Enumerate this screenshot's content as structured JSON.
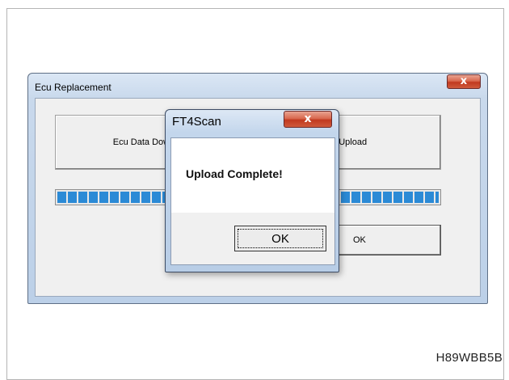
{
  "main_window": {
    "title": "Ecu Replacement",
    "close_glyph": "x",
    "download_button_label": "Ecu Data Down",
    "upload_button_label": "ta Upload",
    "ok_button_label": "OK",
    "progress_fraction": 1.0
  },
  "message_box": {
    "title": "FT4Scan",
    "close_glyph": "x",
    "message": "Upload Complete!",
    "ok_button_label": "OK"
  },
  "figure_code": "H89WBB5B",
  "colors": {
    "progress_blue": "#2b8ad6",
    "close_button_red": "#c1391f",
    "window_frame": "#bcd0e8"
  },
  "icons": [
    "close-icon"
  ]
}
